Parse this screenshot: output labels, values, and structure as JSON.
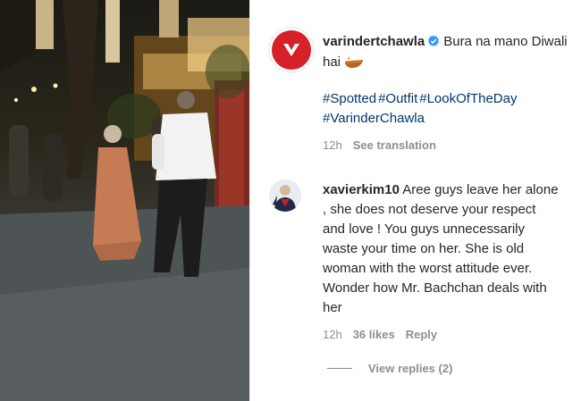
{
  "post": {
    "username": "varindertchawla",
    "verified_icon": "verified-badge-icon",
    "caption": "Bura na mano Diwali hai",
    "caption_emoji": "diya-lamp-icon",
    "hashtags": [
      "#Spotted",
      "#Outfit",
      "#LookOfTheDay",
      "#VarinderChawla"
    ],
    "time": "12h",
    "see_translation": "See translation",
    "avatar_brand_color": "#d6202a"
  },
  "comment": {
    "username": "xavierkim10",
    "text": "Aree guys leave her alone , she does not deserve your respect and love ! You guys unnecessarily waste your time on her. She is old woman with the worst attitude ever. Wonder how Mr. Bachchan deals with her",
    "time": "12h",
    "likes": "36 likes",
    "reply": "Reply",
    "view_replies": "View replies (2)"
  },
  "colors": {
    "text": "#262626",
    "muted": "#8e8e8e",
    "hashtag": "#00376b",
    "verified": "#3897f0"
  }
}
